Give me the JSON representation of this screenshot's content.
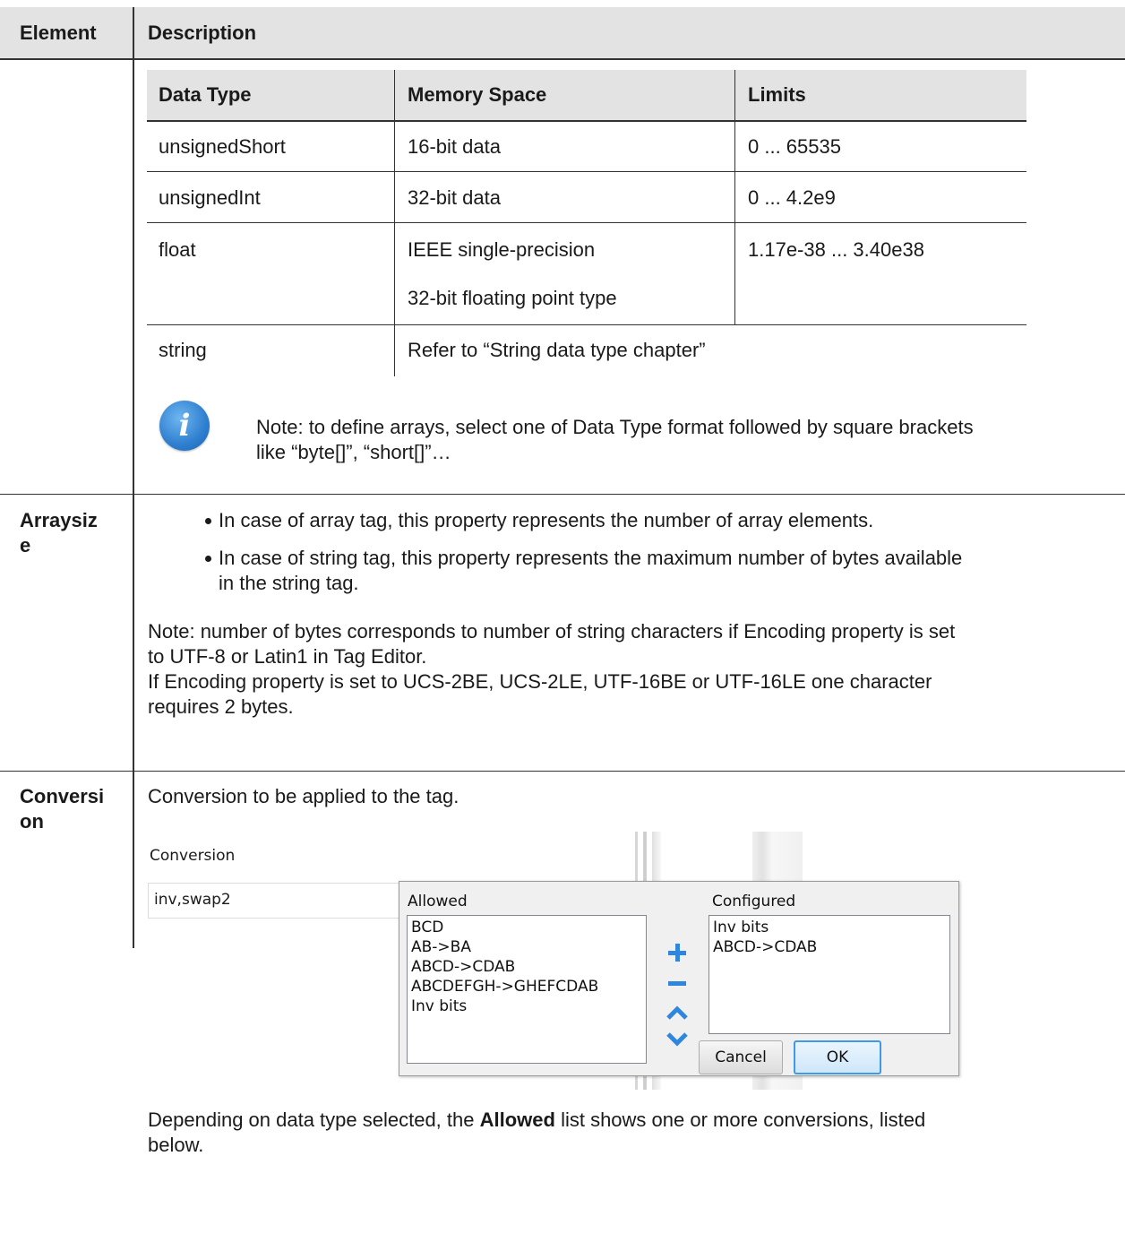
{
  "header": {
    "col_element": "Element",
    "col_description": "Description"
  },
  "data_type_table": {
    "headers": [
      "Data Type",
      "Memory Space",
      "Limits"
    ],
    "rows": [
      {
        "type": "unsignedShort",
        "memory": "16-bit data",
        "limits": "0 ... 65535"
      },
      {
        "type": "unsignedInt",
        "memory": "32-bit data",
        "limits": "0 ... 4.2e9"
      },
      {
        "type": "float",
        "memory": "IEEE single-precision",
        "memory2": "32-bit floating point type",
        "limits": "1.17e-38 ... 3.40e38"
      },
      {
        "type": "string",
        "memory": "Refer to “String data type chapter”"
      }
    ]
  },
  "note_arrays": {
    "line1": "Note: to define arrays, select one of Data Type format followed by square brackets",
    "line2": "like “byte[]”, “short[]”…"
  },
  "arraysize": {
    "label_line1": "Arraysiz",
    "label_line2": "e",
    "bullets": [
      "In case of array tag, this property represents the number of array elements.",
      "In case of string tag, this property represents the maximum number of bytes available",
      "in the string tag."
    ],
    "note_lines": [
      "Note: number of bytes corresponds to number of string characters if Encoding property is set",
      "to UTF-8 or Latin1 in Tag Editor.",
      "If Encoding property is set to UCS-2BE, UCS-2LE, UTF-16BE or UTF-16LE one character",
      "requires 2 bytes."
    ]
  },
  "conversion": {
    "label_line1": "Conversi",
    "label_line2": "on",
    "intro": "Conversion to be applied to the tag.",
    "screenshot": {
      "field_label": "Conversion",
      "field_value": "inv,swap2",
      "allowed_label": "Allowed",
      "allowed_items": [
        "BCD",
        "AB->BA",
        "ABCD->CDAB",
        "ABCDEFGH->GHEFCDAB",
        "Inv bits"
      ],
      "configured_label": "Configured",
      "configured_items": [
        "Inv bits",
        "ABCD->CDAB"
      ],
      "cancel_label": "Cancel",
      "ok_label": "OK",
      "icons": [
        "plus-icon",
        "minus-icon",
        "chevron-up-icon",
        "chevron-down-icon"
      ]
    },
    "footer_pre": "Depending on data type selected, the ",
    "footer_bold": "Allowed",
    "footer_post": " list shows one or more conversions, listed",
    "footer_line2": "below."
  }
}
